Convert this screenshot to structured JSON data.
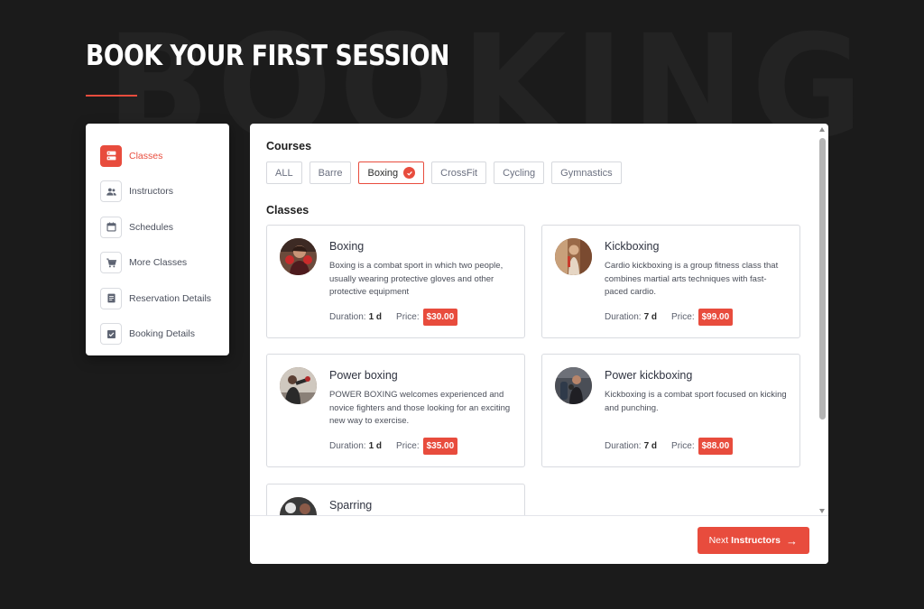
{
  "background_word": "BOOKING",
  "hero": {
    "title": "BOOK YOUR FIRST SESSION"
  },
  "colors": {
    "accent": "#e84c3d",
    "page_bg": "#1b1b1b",
    "panel_bg": "#ffffff"
  },
  "sidebar": {
    "items": [
      {
        "label": "Classes",
        "icon": "classes-icon",
        "active": true
      },
      {
        "label": "Instructors",
        "icon": "instructors-icon",
        "active": false
      },
      {
        "label": "Schedules",
        "icon": "calendar-icon",
        "active": false
      },
      {
        "label": "More Classes",
        "icon": "cart-icon",
        "active": false
      },
      {
        "label": "Reservation Details",
        "icon": "document-icon",
        "active": false
      },
      {
        "label": "Booking Details",
        "icon": "checklist-icon",
        "active": false
      }
    ]
  },
  "courses": {
    "title": "Courses",
    "filters": [
      {
        "label": "ALL",
        "selected": false
      },
      {
        "label": "Barre",
        "selected": false
      },
      {
        "label": "Boxing",
        "selected": true
      },
      {
        "label": "CrossFit",
        "selected": false
      },
      {
        "label": "Cycling",
        "selected": false
      },
      {
        "label": "Gymnastics",
        "selected": false
      }
    ]
  },
  "classes": {
    "title": "Classes",
    "duration_label": "Duration:",
    "price_label": "Price:",
    "items": [
      {
        "name": "Boxing",
        "description": "Boxing is a combat sport in which two people, usually wearing protective gloves and other protective equipment",
        "duration": "1 d",
        "price": "$30.00"
      },
      {
        "name": "Kickboxing",
        "description": "Cardio kickboxing is a group fitness class that combines martial arts techniques with fast-paced cardio.",
        "duration": "7 d",
        "price": "$99.00"
      },
      {
        "name": "Power boxing",
        "description": "POWER BOXING welcomes experienced and novice fighters and those looking for an exciting new way to exercise.",
        "duration": "1 d",
        "price": "$35.00"
      },
      {
        "name": "Power kickboxing",
        "description": "Kickboxing is a combat sport focused on kicking and punching.",
        "duration": "7 d",
        "price": "$88.00"
      },
      {
        "name": "Sparring",
        "description": "",
        "duration": "",
        "price": ""
      }
    ]
  },
  "footer": {
    "next_prefix": "Next",
    "next_target": "Instructors"
  }
}
